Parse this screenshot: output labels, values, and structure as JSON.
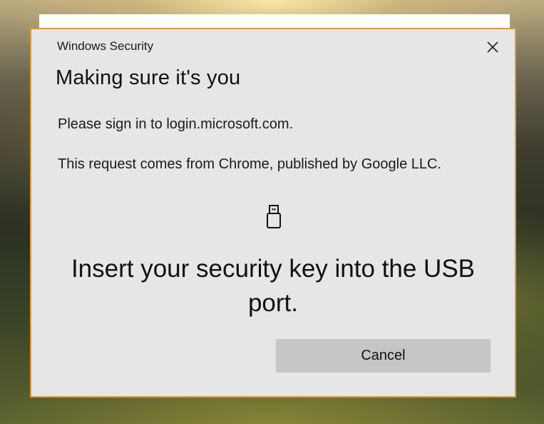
{
  "dialog": {
    "window_title": "Windows Security",
    "heading": "Making sure it's you",
    "paragraphs": [
      "Please sign in to login.microsoft.com.",
      "This request comes from Chrome, published by Google LLC."
    ],
    "icon": "usb-drive-icon",
    "instruction": "Insert your security key into the USB port.",
    "cancel_label": "Cancel",
    "close_icon": "close-icon",
    "accent_border_color": "#d99a3c"
  }
}
